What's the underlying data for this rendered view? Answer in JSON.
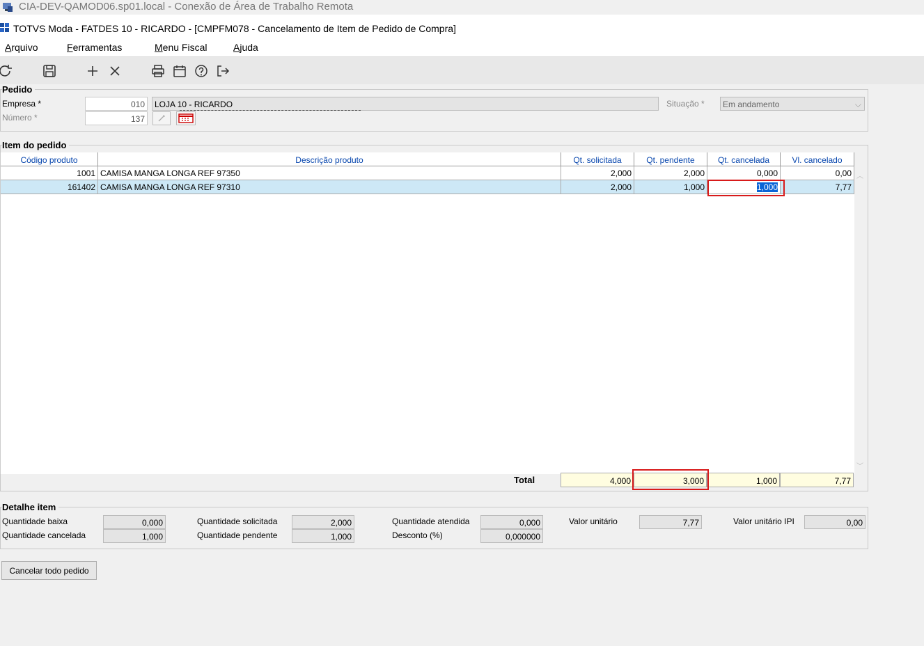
{
  "rdp": {
    "title": "CIA-DEV-QAMOD06.sp01.local - Conexão de Área de Trabalho Remota"
  },
  "app": {
    "title": "TOTVS Moda - FATDES 10 - RICARDO - [CMPFM078 - Cancelamento de Item de Pedido de Compra]"
  },
  "menu": [
    {
      "label": "Arquivo",
      "u": "A",
      "rest": "rquivo"
    },
    {
      "label": "Ferramentas",
      "u": "F",
      "rest": "erramentas"
    },
    {
      "label": "Menu Fiscal",
      "u": "M",
      "rest": "enu Fiscal"
    },
    {
      "label": "Ajuda",
      "u": "A",
      "rest": "juda"
    }
  ],
  "toolbar": [
    "refresh-icon",
    "save-icon",
    "add-icon",
    "delete-icon",
    "print-icon",
    "calendar-icon",
    "help-icon",
    "exit-icon"
  ],
  "pedido": {
    "title": "Pedido",
    "empresa_label": "Empresa *",
    "empresa_code": "010",
    "empresa_name": "LOJA 10 - RICARDO",
    "numero_label": "Número *",
    "numero_value": "137",
    "situacao_label": "Situação *",
    "situacao_value": "Em andamento"
  },
  "items": {
    "title": "Item do pedido",
    "columns": [
      "Código produto",
      "Descrição produto",
      "Qt. solicitada",
      "Qt. pendente",
      "Qt. cancelada",
      "Vl. cancelado"
    ],
    "rows": [
      {
        "codigo": "1001",
        "descricao": "CAMISA MANGA LONGA REF 97350",
        "solicitada": "2,000",
        "pendente": "2,000",
        "cancelada": "0,000",
        "valor": "0,00"
      },
      {
        "codigo": "161402",
        "descricao": "CAMISA MANGA LONGA REF 97310",
        "solicitada": "2,000",
        "pendente": "1,000",
        "cancelada": "1,000",
        "valor": "7,77"
      }
    ],
    "total_label": "Total",
    "totals": {
      "solicitada": "4,000",
      "pendente": "3,000",
      "cancelada": "1,000",
      "valor": "7,77"
    }
  },
  "detalhe": {
    "title": "Detalhe item",
    "quantidade_baixa_label": "Quantidade baixa",
    "quantidade_baixa": "0,000",
    "quantidade_cancelada_label": "Quantidade cancelada",
    "quantidade_cancelada": "1,000",
    "quantidade_solicitada_label": "Quantidade solicitada",
    "quantidade_solicitada": "2,000",
    "quantidade_pendente_label": "Quantidade pendente",
    "quantidade_pendente": "1,000",
    "quantidade_atendida_label": "Quantidade atendida",
    "quantidade_atendida": "0,000",
    "desconto_label": "Desconto (%)",
    "desconto": "0,000000",
    "valor_unitario_label": "Valor unitário",
    "valor_unitario": "7,77",
    "valor_unitario_ipi_label": "Valor unitário IPI",
    "valor_unitario_ipi": "0,00"
  },
  "buttons": {
    "cancelar_todo": "Cancelar todo pedido"
  },
  "colors": {
    "selected_row": "#cde8f6",
    "highlight": "#d81a1a",
    "total_bg": "#fffde0",
    "header_text": "#0645ad"
  }
}
